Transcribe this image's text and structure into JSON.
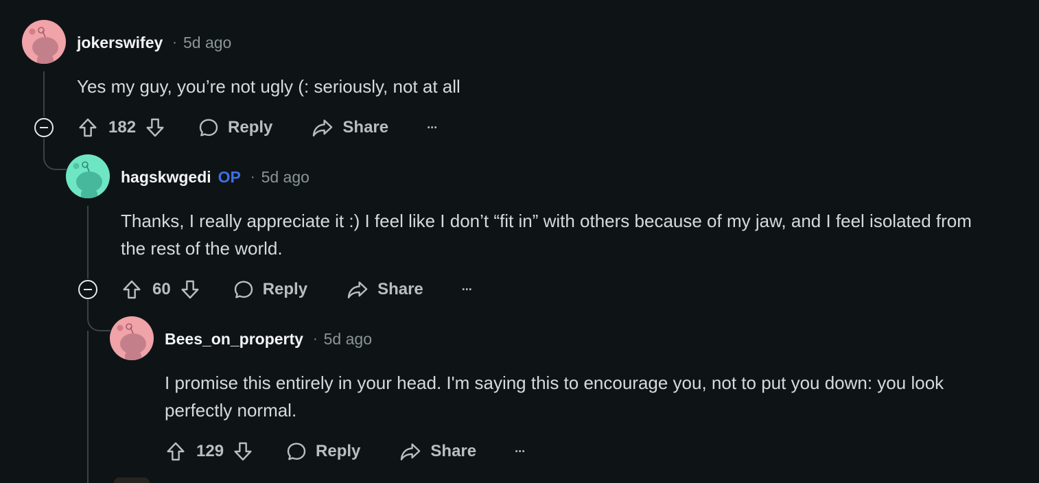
{
  "comments": [
    {
      "username": "jokerswifey",
      "is_op": false,
      "op_label": "",
      "separator": "·",
      "time": "5d ago",
      "body": "Yes my guy, you’re not ugly (: seriously, not at all",
      "score": "182",
      "reply_label": "Reply",
      "share_label": "Share",
      "more_label": "···",
      "avatar_color": "#f0a3a8",
      "avatar_icon_color": "#c4808a"
    },
    {
      "username": "hagskwgedi",
      "is_op": true,
      "op_label": "OP",
      "separator": "·",
      "time": "5d ago",
      "body": "Thanks, I really appreciate it :) I feel like I don’t “fit in” with others because of my jaw, and I feel isolated from the rest of the world.",
      "score": "60",
      "reply_label": "Reply",
      "share_label": "Share",
      "more_label": "···",
      "avatar_color": "#6ee6c4",
      "avatar_icon_color": "#48b89c"
    },
    {
      "username": "Bees_on_property",
      "is_op": false,
      "op_label": "",
      "separator": "·",
      "time": "5d ago",
      "body": "I promise this entirely in your head. I'm saying this to encourage you, not to put you down: you look perfectly normal.",
      "score": "129",
      "reply_label": "Reply",
      "share_label": "Share",
      "more_label": "···",
      "avatar_color": "#f0a3a8",
      "avatar_icon_color": "#c4808a"
    }
  ],
  "colors": {
    "background": "#0e1416",
    "op_badge": "#3d6fe8",
    "thread_line": "#3b4347"
  },
  "icons": [
    "snoo-avatar-icon",
    "upvote-icon",
    "downvote-icon",
    "reply-bubble-icon",
    "share-arrow-icon",
    "more-options-icon",
    "collapse-thread-icon"
  ]
}
